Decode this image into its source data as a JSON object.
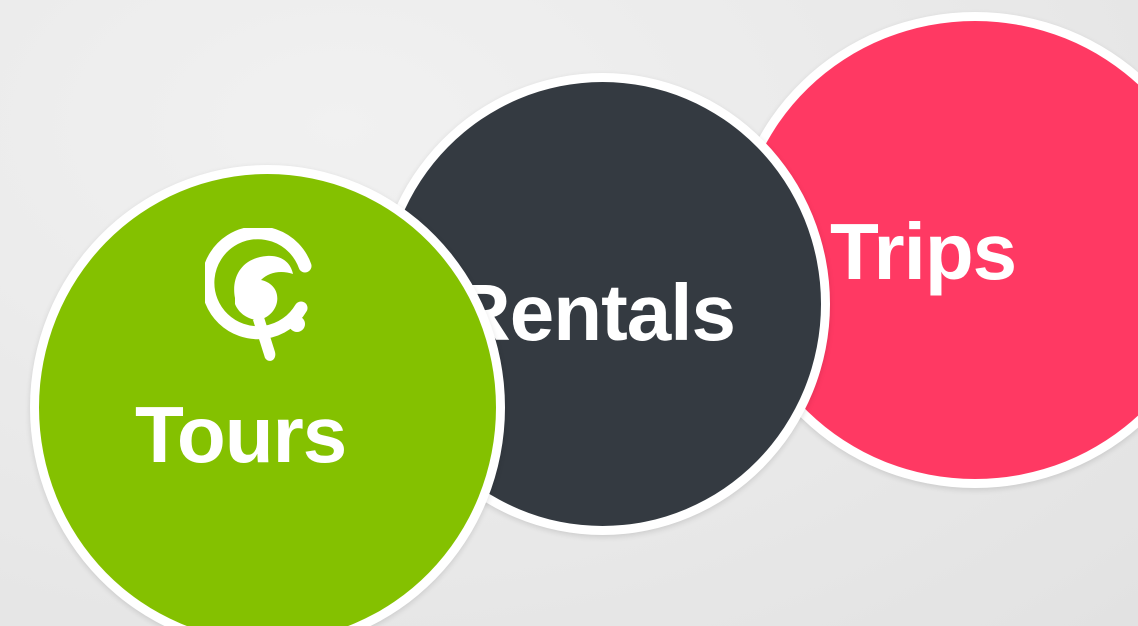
{
  "categories": [
    {
      "id": "tours",
      "label": "Tours",
      "color": "#84c100"
    },
    {
      "id": "rentals",
      "label": "Rentals",
      "color": "#343a41"
    },
    {
      "id": "trips",
      "label": "Trips",
      "color": "#ff3963"
    }
  ],
  "logo": {
    "icon": "brand-logo-icon"
  },
  "background_color": "#e9e9e9",
  "border_color": "#ffffff"
}
